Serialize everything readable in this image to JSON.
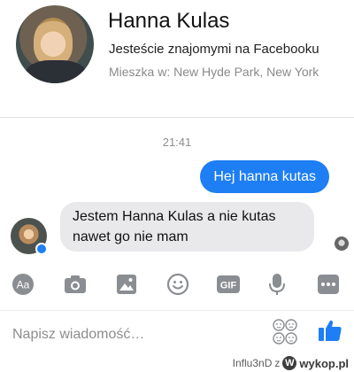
{
  "profile": {
    "name": "Hanna Kulas",
    "friends_status": "Jesteście znajomymi na Facebooku",
    "lives_in": "Mieszka w: New Hyde Park, New York"
  },
  "conversation": {
    "timestamp": "21:41",
    "messages": [
      {
        "from": "me",
        "text": "Hej hanna kutas"
      },
      {
        "from": "contact",
        "text": "Jestem Hanna Kulas a nie kutas nawet go nie mam"
      }
    ]
  },
  "toolbar": {
    "icons": [
      "text-aa-icon",
      "camera-icon",
      "image-icon",
      "emoji-icon",
      "gif-icon",
      "microphone-icon",
      "more-icon"
    ],
    "aa_label": "Aa",
    "gif_label": "GIF"
  },
  "composer": {
    "placeholder": "Napisz wiadomość…"
  },
  "watermark": {
    "user": "Influ3nD",
    "separator": "z",
    "site": "wykop.pl"
  },
  "colors": {
    "accent": "#1e7ef4",
    "incoming_bubble": "#e9e9eb",
    "icon_gray": "#8a8d91"
  }
}
